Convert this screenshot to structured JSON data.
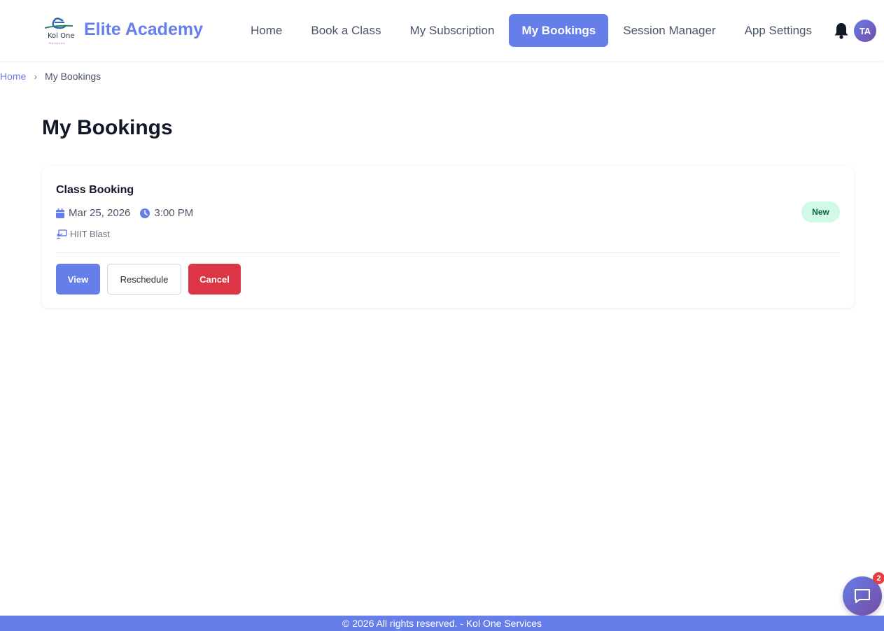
{
  "brand": {
    "logo_text": "Kol One",
    "logo_subtext": "Services",
    "name": "Elite Academy"
  },
  "nav": {
    "items": [
      {
        "label": "Home",
        "active": false
      },
      {
        "label": "Book a Class",
        "active": false
      },
      {
        "label": "My Subscription",
        "active": false
      },
      {
        "label": "My Bookings",
        "active": true
      },
      {
        "label": "Session Manager",
        "active": false
      },
      {
        "label": "App Settings",
        "active": false
      }
    ],
    "avatar_initials": "TA"
  },
  "breadcrumb": {
    "home": "Home",
    "separator": "›",
    "current": "My Bookings"
  },
  "page": {
    "title": "My Bookings"
  },
  "booking": {
    "title": "Class Booking",
    "date": "Mar 25, 2026",
    "time": "3:00 PM",
    "class_name": "HIIT Blast",
    "status": "New",
    "actions": {
      "view": "View",
      "reschedule": "Reschedule",
      "cancel": "Cancel"
    }
  },
  "chat": {
    "badge_count": "2"
  },
  "footer": {
    "text": "© 2026 All rights reserved. - Kol One Services"
  },
  "colors": {
    "primary": "#667eea",
    "danger": "#dc3545",
    "status_new_bg": "#d1fae5"
  }
}
